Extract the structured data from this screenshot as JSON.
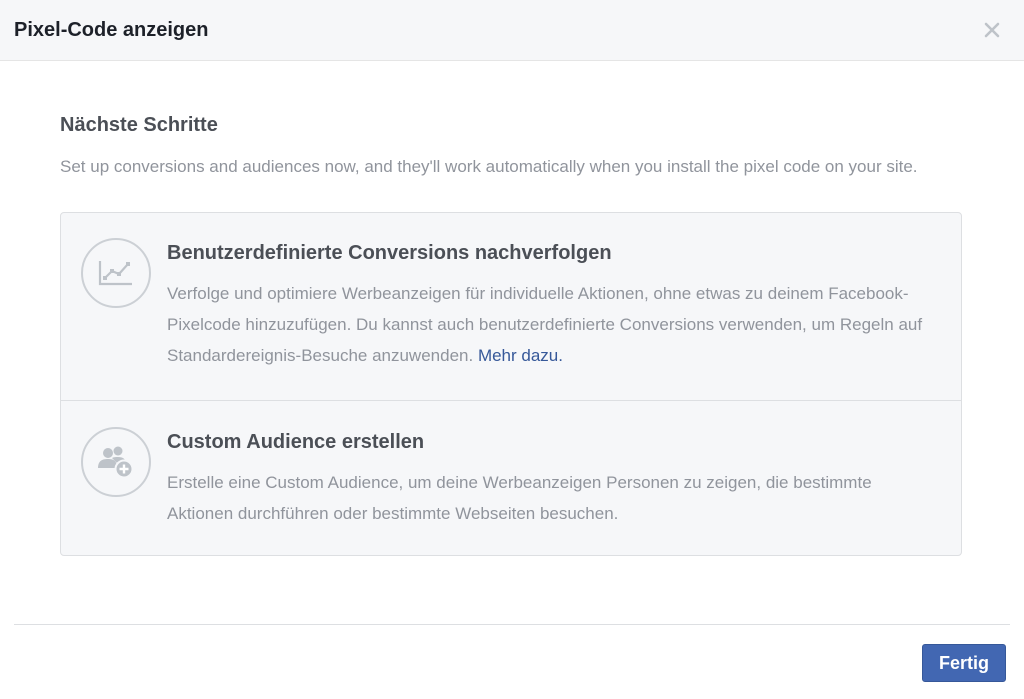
{
  "dialog": {
    "title": "Pixel-Code anzeigen",
    "close_icon": "close-icon"
  },
  "next_steps": {
    "title": "Nächste Schritte",
    "description": "Set up conversions and audiences now, and they'll work automatically when you install the pixel code on your site."
  },
  "options": [
    {
      "icon": "line-chart-icon",
      "title": "Benutzerdefinierte Conversions nachverfolgen",
      "text": "Verfolge und optimiere Werbeanzeigen für individuelle Aktionen, ohne etwas zu deinem Facebook-Pixelcode hinzuzufügen. Du kannst auch benutzerdefinierte Conversions verwenden, um Regeln auf Standardereignis-Besuche anzuwenden. ",
      "link": "Mehr dazu."
    },
    {
      "icon": "add-audience-icon",
      "title": "Custom Audience erstellen",
      "text": "Erstelle eine Custom Audience, um deine Werbeanzeigen Personen zu zeigen, die bestimmte Aktionen durchführen oder bestimmte Webseiten besuchen."
    }
  ],
  "footer": {
    "done_label": "Fertig"
  },
  "colors": {
    "primary_button": "#4267b2",
    "link": "#365899",
    "muted_text": "#90949c",
    "heading_text": "#4b4f56"
  }
}
